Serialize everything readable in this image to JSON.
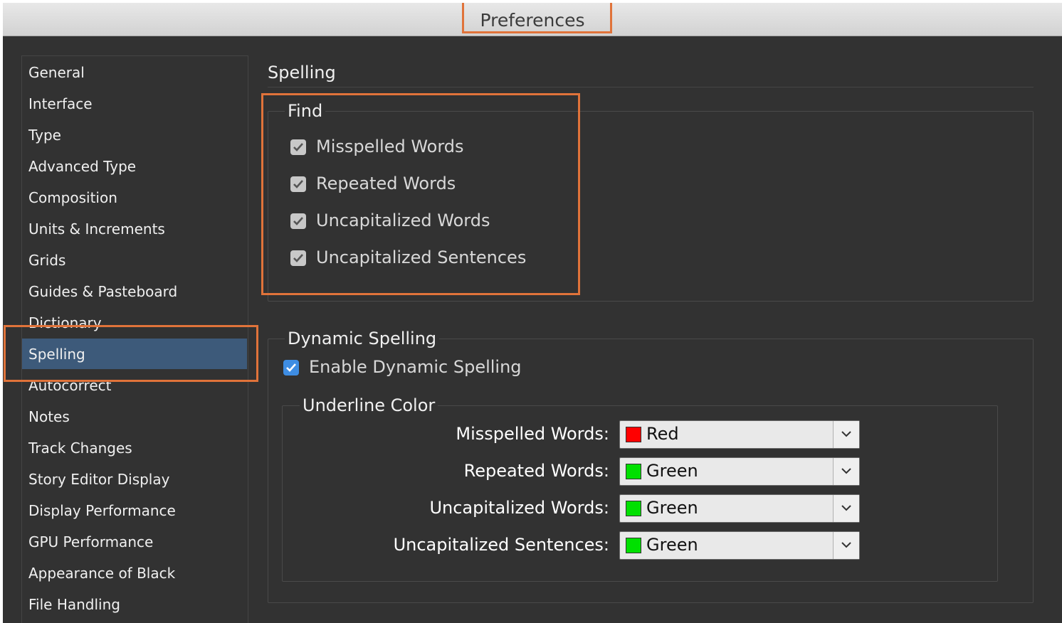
{
  "window": {
    "title": "Preferences"
  },
  "sidebar": {
    "items": [
      {
        "label": "General"
      },
      {
        "label": "Interface"
      },
      {
        "label": "Type"
      },
      {
        "label": "Advanced Type"
      },
      {
        "label": "Composition"
      },
      {
        "label": "Units & Increments"
      },
      {
        "label": "Grids"
      },
      {
        "label": "Guides & Pasteboard"
      },
      {
        "label": "Dictionary"
      },
      {
        "label": "Spelling"
      },
      {
        "label": "Autocorrect"
      },
      {
        "label": "Notes"
      },
      {
        "label": "Track Changes"
      },
      {
        "label": "Story Editor Display"
      },
      {
        "label": "Display Performance"
      },
      {
        "label": "GPU Performance"
      },
      {
        "label": "Appearance of Black"
      },
      {
        "label": "File Handling"
      }
    ],
    "selected": "Spelling"
  },
  "main": {
    "title": "Spelling",
    "find": {
      "label": "Find",
      "options": [
        {
          "label": "Misspelled Words",
          "checked": true
        },
        {
          "label": "Repeated Words",
          "checked": true
        },
        {
          "label": "Uncapitalized Words",
          "checked": true
        },
        {
          "label": "Uncapitalized Sentences",
          "checked": true
        }
      ]
    },
    "dynamic": {
      "label": "Dynamic Spelling",
      "enable_label": "Enable Dynamic Spelling",
      "enabled": true,
      "underline": {
        "label": "Underline Color",
        "rows": [
          {
            "label": "Misspelled Words:",
            "value": "Red",
            "color": "#ff0000"
          },
          {
            "label": "Repeated Words:",
            "value": "Green",
            "color": "#00e000"
          },
          {
            "label": "Uncapitalized Words:",
            "value": "Green",
            "color": "#00e000"
          },
          {
            "label": "Uncapitalized Sentences:",
            "value": "Green",
            "color": "#00e000"
          }
        ]
      }
    }
  },
  "colors": {
    "highlight": "#e0733a",
    "selection": "#3d5a7a",
    "panel": "#323232"
  }
}
